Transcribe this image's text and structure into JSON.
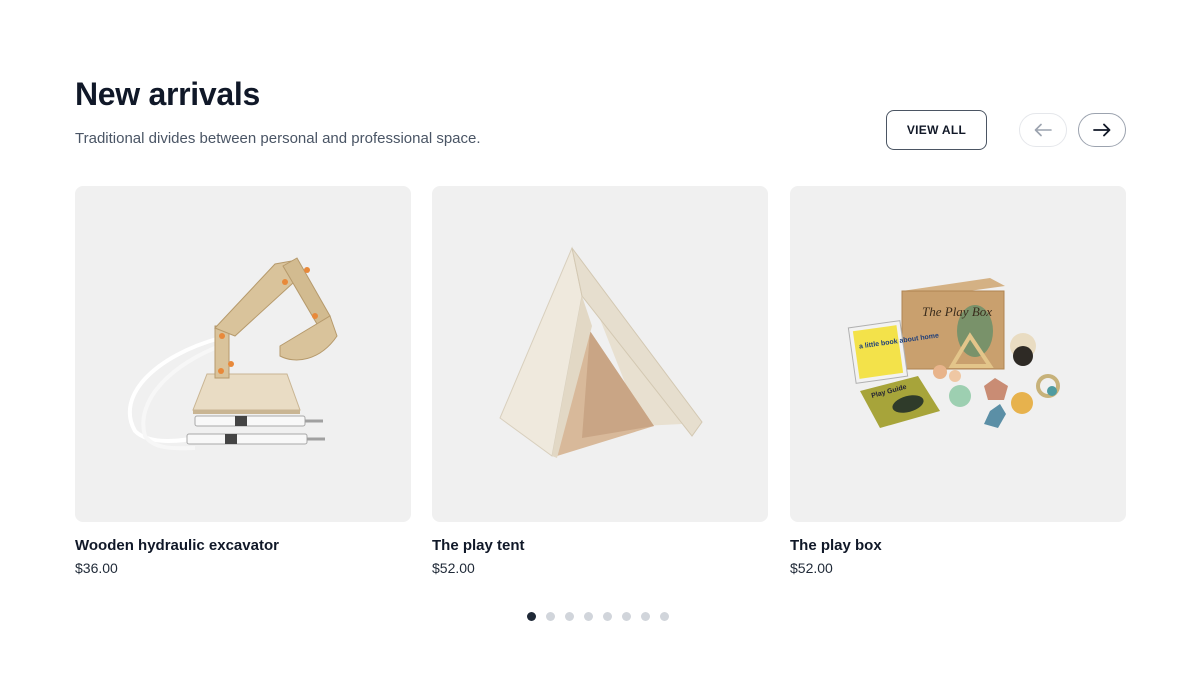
{
  "section": {
    "title": "New arrivals",
    "subtitle": "Traditional divides between personal and professional space."
  },
  "controls": {
    "view_all_label": "VIEW ALL",
    "prev_icon": "arrow-left-icon",
    "next_icon": "arrow-right-icon"
  },
  "products": [
    {
      "name": "Wooden hydraulic excavator",
      "price": "$36.00",
      "image": "excavator-toy-image"
    },
    {
      "name": "The play tent",
      "price": "$52.00",
      "image": "play-tent-image"
    },
    {
      "name": "The play box",
      "price": "$52.00",
      "image": "play-box-image"
    }
  ],
  "pagination": {
    "total": 8,
    "active_index": 0
  },
  "illustration_text": {
    "box_title": "The Play Box",
    "book_cover": "a little book about home",
    "guide_cover": "Play Guide"
  },
  "colors": {
    "primary_text": "#101828",
    "muted_text": "#4a5565",
    "card_bg": "#f0f0f0",
    "dot_active": "#1f2937",
    "dot_inactive": "#d1d5db"
  }
}
